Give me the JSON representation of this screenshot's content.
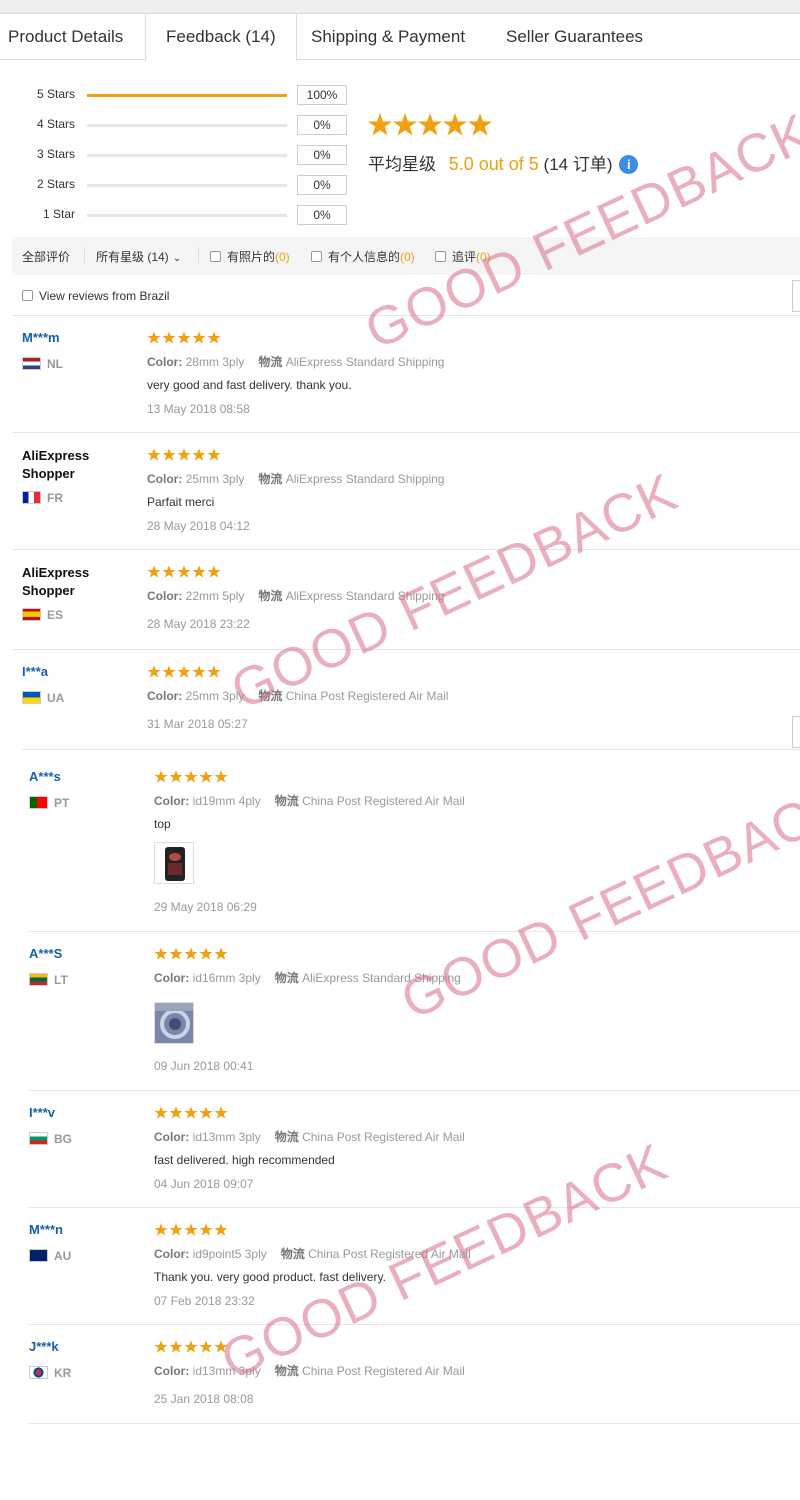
{
  "tabs": [
    {
      "label": "Product Details"
    },
    {
      "label": "Feedback (14)"
    },
    {
      "label": "Shipping & Payment"
    },
    {
      "label": "Seller Guarantees"
    }
  ],
  "distribution": [
    {
      "label": "5 Stars",
      "percent": "100%",
      "fill": 1.0
    },
    {
      "label": "4 Stars",
      "percent": "0%",
      "fill": 0
    },
    {
      "label": "3 Stars",
      "percent": "0%",
      "fill": 0
    },
    {
      "label": "2 Stars",
      "percent": "0%",
      "fill": 0
    },
    {
      "label": "1 Star",
      "percent": "0%",
      "fill": 0
    }
  ],
  "summary": {
    "avg_label": "平均星级",
    "avg_value": "5.0 out of 5",
    "order_count": "(14 订单)",
    "info_icon": "i"
  },
  "filters": {
    "all": "全部评价",
    "all_stars": "所有星级 (14)",
    "with_photos": "有照片的",
    "with_photos_count": "(0)",
    "with_info": "有个人信息的",
    "with_info_count": "(0)",
    "followup": "追评",
    "followup_count": "(0)"
  },
  "view_brazil": "View reviews from Brazil",
  "color_label": "Color:",
  "logistics_label": "物流",
  "reviews": [
    {
      "name": "M***m",
      "country": "NL",
      "color": "28mm 3ply",
      "shipping": "AliExpress Standard Shipping",
      "text": "very good and fast delivery. thank you.",
      "date": "13 May 2018 08:58"
    },
    {
      "name": "AliExpress Shopper",
      "country": "FR",
      "color": "25mm 3ply",
      "shipping": "AliExpress Standard Shipping",
      "text": "Parfait merci",
      "date": "28 May 2018 04:12"
    },
    {
      "name": "AliExpress Shopper",
      "country": "ES",
      "color": "22mm 5ply",
      "shipping": "AliExpress Standard Shipping",
      "text": "",
      "date": "28 May 2018 23:22"
    },
    {
      "name": "I***a",
      "country": "UA",
      "color": "25mm 3ply",
      "shipping": "China Post Registered Air Mail",
      "text": "",
      "date": "31 Mar 2018 05:27"
    },
    {
      "name": "A***s",
      "country": "PT",
      "color": "id19mm 4ply",
      "shipping": "China Post Registered Air Mail",
      "text": "top",
      "date": "29 May 2018 06:29"
    },
    {
      "name": "A***S",
      "country": "LT",
      "color": "id16mm 3ply",
      "shipping": "AliExpress Standard Shipping",
      "text": "",
      "date": "09 Jun 2018 00:41"
    },
    {
      "name": "I***v",
      "country": "BG",
      "color": "id13mm 3ply",
      "shipping": "China Post Registered Air Mail",
      "text": "fast delivered. high recommended",
      "date": "04 Jun 2018 09:07"
    },
    {
      "name": "M***n",
      "country": "AU",
      "color": "id9point5 3ply",
      "shipping": "China Post Registered Air Mail",
      "text": "Thank you. very good product. fast delivery.",
      "date": "07 Feb 2018 23:32"
    },
    {
      "name": "J***k",
      "country": "KR",
      "color": "id13mm 3ply",
      "shipping": "China Post Registered Air Mail",
      "text": "",
      "date": "25 Jan 2018 08:08"
    }
  ],
  "watermark": "GOOD FEEDBACK",
  "colors": {
    "star": "#f0a010",
    "link": "#1a5fa8",
    "watermark": "#d76e87"
  }
}
